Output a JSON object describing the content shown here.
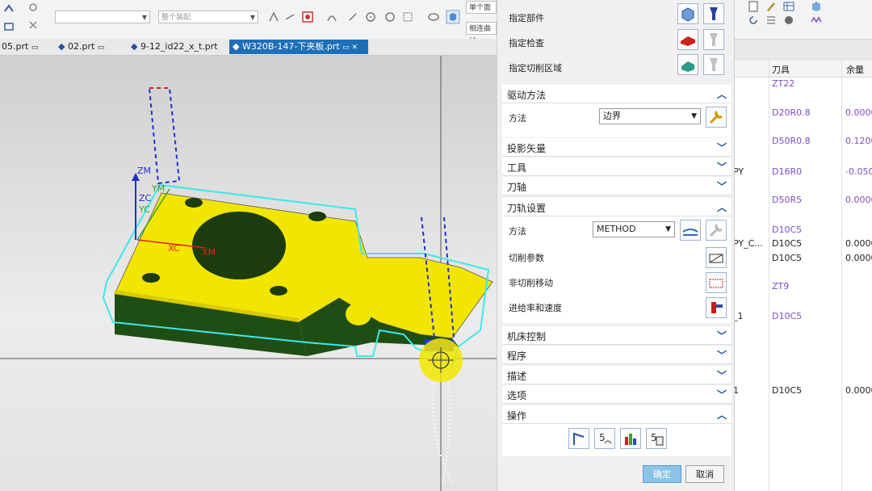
{
  "toolbar": {
    "filter_placeholder": "",
    "assembly_scope": "整个装配",
    "select_single": "单个面",
    "select_adjacent": "相连曲线"
  },
  "tabs": [
    {
      "label": "05.prt"
    },
    {
      "label": "02.prt"
    },
    {
      "label": "9-12_id22_x_t.prt"
    },
    {
      "label": "W320B-147-下夹板.prt"
    }
  ],
  "viewport": {
    "axis_zm": "ZM",
    "axis_zc": "ZC",
    "axis_ym": "YM",
    "axis_yc": "YC",
    "axis_xc": "XC",
    "axis_xm": "XM"
  },
  "dialog": {
    "geometry_rows": [
      "指定部件",
      "指定检查",
      "指定切削区域"
    ],
    "sections": {
      "drive_method": "驱动方法",
      "projection_vector": "投影矢量",
      "tool": "工具",
      "tool_axis": "刀轴",
      "path_settings": "刀轨设置",
      "machine_control": "机床控制",
      "program": "程序",
      "description": "描述",
      "options": "选项",
      "actions": "操作"
    },
    "drive": {
      "method_label": "方法",
      "method_value": "边界"
    },
    "path": {
      "method_label": "方法",
      "method_value": "METHOD",
      "cut_params": "切削参数",
      "non_cut_moves": "非切削移动",
      "feeds_speeds": "进给率和速度"
    },
    "ok": "确定",
    "cancel": "取消"
  },
  "right_table": {
    "header_tool": "刀具",
    "header_stock": "余量",
    "rows": [
      {
        "left": "",
        "tool": "ZT22",
        "stock": "",
        "tool_color": "purple"
      },
      {
        "left": "",
        "tool": "D20R0.8",
        "stock": "0.0000",
        "tool_color": "purple"
      },
      {
        "left": "",
        "tool": "D50R0.8",
        "stock": "0.1200",
        "tool_color": "purple"
      },
      {
        "left": "PY",
        "tool": "D16R0",
        "stock": "-0.050",
        "tool_color": "purple"
      },
      {
        "left": "",
        "tool": "D50R5",
        "stock": "0.0000",
        "tool_color": "purple"
      },
      {
        "left": "",
        "tool": "D10C5",
        "stock": "",
        "tool_color": "purple"
      },
      {
        "left": "PY_C...",
        "tool": "D10C5",
        "stock": "0.0000",
        "tool_color": "dark"
      },
      {
        "left": "",
        "tool": "D10C5",
        "stock": "0.0000",
        "tool_color": "dark"
      },
      {
        "left": "",
        "tool": "ZT9",
        "stock": "",
        "tool_color": "purple"
      },
      {
        "left": "_1",
        "tool": "D10C5",
        "stock": "",
        "tool_color": "purple"
      },
      {
        "left": "1",
        "tool": "D10C5",
        "stock": "0.0000",
        "tool_color": "dark"
      }
    ]
  }
}
